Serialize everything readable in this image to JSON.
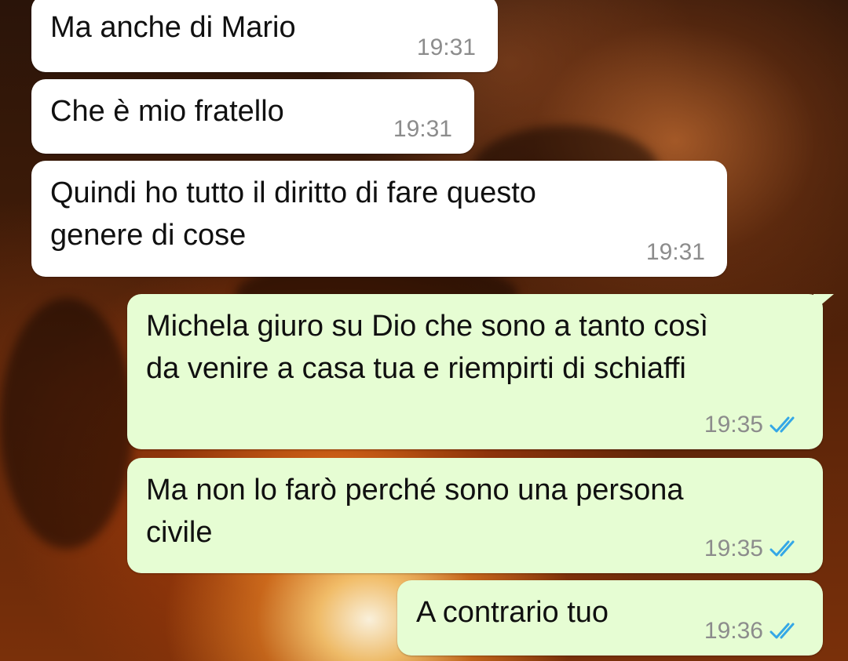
{
  "colors": {
    "incoming_bubble": "#ffffff",
    "outgoing_bubble": "#e6fdd3",
    "timestamp": "#8c8c8c",
    "read_ticks": "#34a7e6"
  },
  "messages": [
    {
      "direction": "incoming",
      "text": "Ma anche di Mario",
      "time": "19:31"
    },
    {
      "direction": "incoming",
      "text": "Che è mio fratello",
      "time": "19:31"
    },
    {
      "direction": "incoming",
      "text": "Quindi ho tutto il diritto di fare questo\ngenere di cose",
      "time": "19:31"
    },
    {
      "direction": "outgoing",
      "text": "Michela giuro su Dio che sono a tanto così\nda venire a casa tua e riempirti di schiaffi",
      "time": "19:35",
      "status_icon": "double-check-read-icon"
    },
    {
      "direction": "outgoing",
      "text": "Ma non lo farò perché sono una persona\ncivile",
      "time": "19:35",
      "status_icon": "double-check-read-icon"
    },
    {
      "direction": "outgoing",
      "text": "A contrario tuo",
      "time": "19:36",
      "status_icon": "double-check-read-icon"
    }
  ]
}
